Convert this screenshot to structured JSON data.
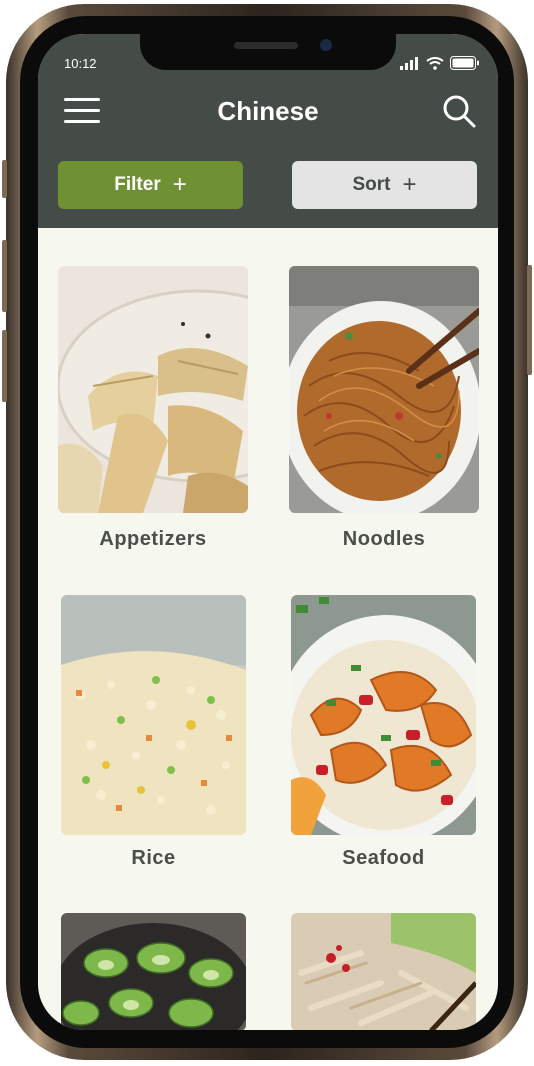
{
  "status_bar": {
    "time": "10:12"
  },
  "header": {
    "title": "Chinese"
  },
  "actions": {
    "filter_label": "Filter",
    "sort_label": "Sort",
    "plus": "+"
  },
  "categories": [
    {
      "label": "Appetizers"
    },
    {
      "label": "Noodles"
    },
    {
      "label": "Rice"
    },
    {
      "label": "Seafood"
    },
    {
      "label": ""
    },
    {
      "label": ""
    }
  ],
  "colors": {
    "header_bg": "#454b47",
    "filter_accent": "#6f9134",
    "sort_bg": "#e4e4e4",
    "content_bg": "#f6f8f0",
    "label_text": "#4a4f4b"
  }
}
